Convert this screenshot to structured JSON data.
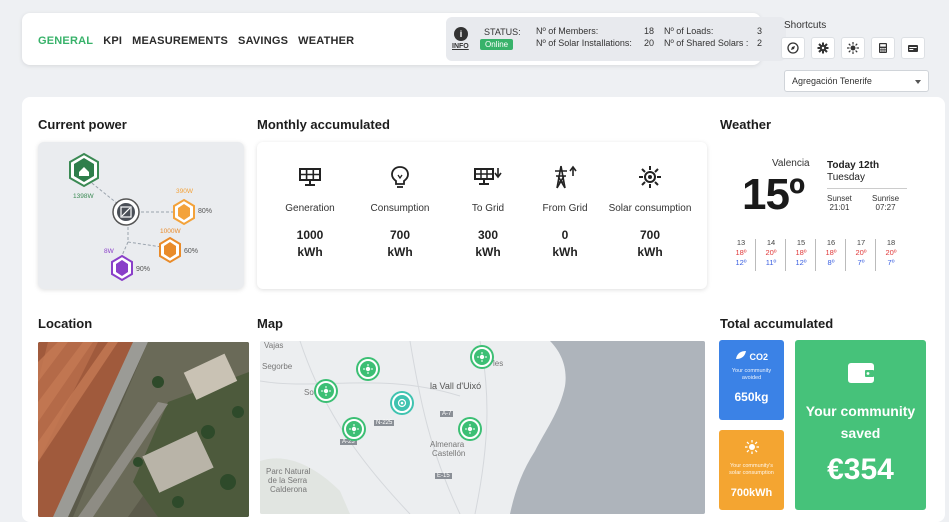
{
  "nav": {
    "tabs": [
      {
        "label": "GENERAL",
        "active": true
      },
      {
        "label": "KPI",
        "active": false
      },
      {
        "label": "MEASUREMENTS",
        "active": false
      },
      {
        "label": "SAVINGS",
        "active": false
      },
      {
        "label": "WEATHER",
        "active": false
      }
    ]
  },
  "status": {
    "info_label": "INFO",
    "status_label": "STATUS:",
    "status_value": "Online",
    "members_label": "Nº of Members:",
    "members_value": "18",
    "solar_label": "Nº of Solar Installations:",
    "solar_value": "20",
    "loads_label": "Nº of Loads:",
    "loads_value": "3",
    "shared_label": "Nº of Shared Solars :",
    "shared_value": "2"
  },
  "shortcuts": {
    "title": "Shortcuts",
    "icons": [
      "compass-icon",
      "gear-icon",
      "sun-icon",
      "calculator-icon",
      "card-icon"
    ]
  },
  "community_select": {
    "value": "Agregación Tenerife"
  },
  "current_power": {
    "title": "Current power",
    "home": "1398W",
    "solar": "390W",
    "solar_pct": "80%",
    "grid": "1000W",
    "grid_pct": "60%",
    "battery": "8W",
    "battery_pct": "90%"
  },
  "monthly": {
    "title": "Monthly accumulated",
    "items": [
      {
        "label": "Generation",
        "value": "1000",
        "unit": "kWh",
        "icon": "solar-panel-icon"
      },
      {
        "label": "Consumption",
        "value": "700",
        "unit": "kWh",
        "icon": "lightbulb-icon"
      },
      {
        "label": "To Grid",
        "value": "300",
        "unit": "kWh",
        "icon": "panel-to-grid-icon"
      },
      {
        "label": "From Grid",
        "value": "0",
        "unit": "kWh",
        "icon": "tower-from-grid-icon"
      },
      {
        "label": "Solar consumption",
        "value": "700",
        "unit": "kWh",
        "icon": "sun-icon"
      }
    ]
  },
  "weather": {
    "title": "Weather",
    "city": "Valencia",
    "temp": "15º",
    "today": "Today 12th",
    "weekday": "Tuesday",
    "sunset_label": "Sunset",
    "sunset_time": "21:01",
    "sunrise_label": "Sunrise",
    "sunrise_time": "07:27",
    "forecast": [
      {
        "day": "13",
        "hi": "18º",
        "lo": "12º"
      },
      {
        "day": "14",
        "hi": "20º",
        "lo": "11º"
      },
      {
        "day": "15",
        "hi": "18º",
        "lo": "12º"
      },
      {
        "day": "16",
        "hi": "18º",
        "lo": "8º"
      },
      {
        "day": "17",
        "hi": "20º",
        "lo": "7º"
      },
      {
        "day": "18",
        "hi": "20º",
        "lo": "7º"
      }
    ]
  },
  "location": {
    "title": "Location"
  },
  "map": {
    "title": "Map",
    "labels": {
      "top": "Vajas",
      "segorbe": "Segorbe",
      "sot": "Sot",
      "vall": "la Vall d'Uixó",
      "almenara": "Almenara",
      "castellon": "Castellón",
      "parc1": "Parc Natural",
      "parc2": "de la Serra",
      "parc3": "Calderona",
      "les": "les",
      "road_n225": "N-225",
      "road_a23": "A-23",
      "road_a7": "A-7",
      "road_e15": "E-15"
    }
  },
  "total": {
    "title": "Total accumulated",
    "co2_label": "CO2",
    "co2_text": "Your community avoided",
    "co2_value": "650kg",
    "solar_text": "Your community's solar consumption",
    "solar_value": "700kWh",
    "saved_line1": "Your community",
    "saved_line2": "saved",
    "saved_value": "€354"
  }
}
